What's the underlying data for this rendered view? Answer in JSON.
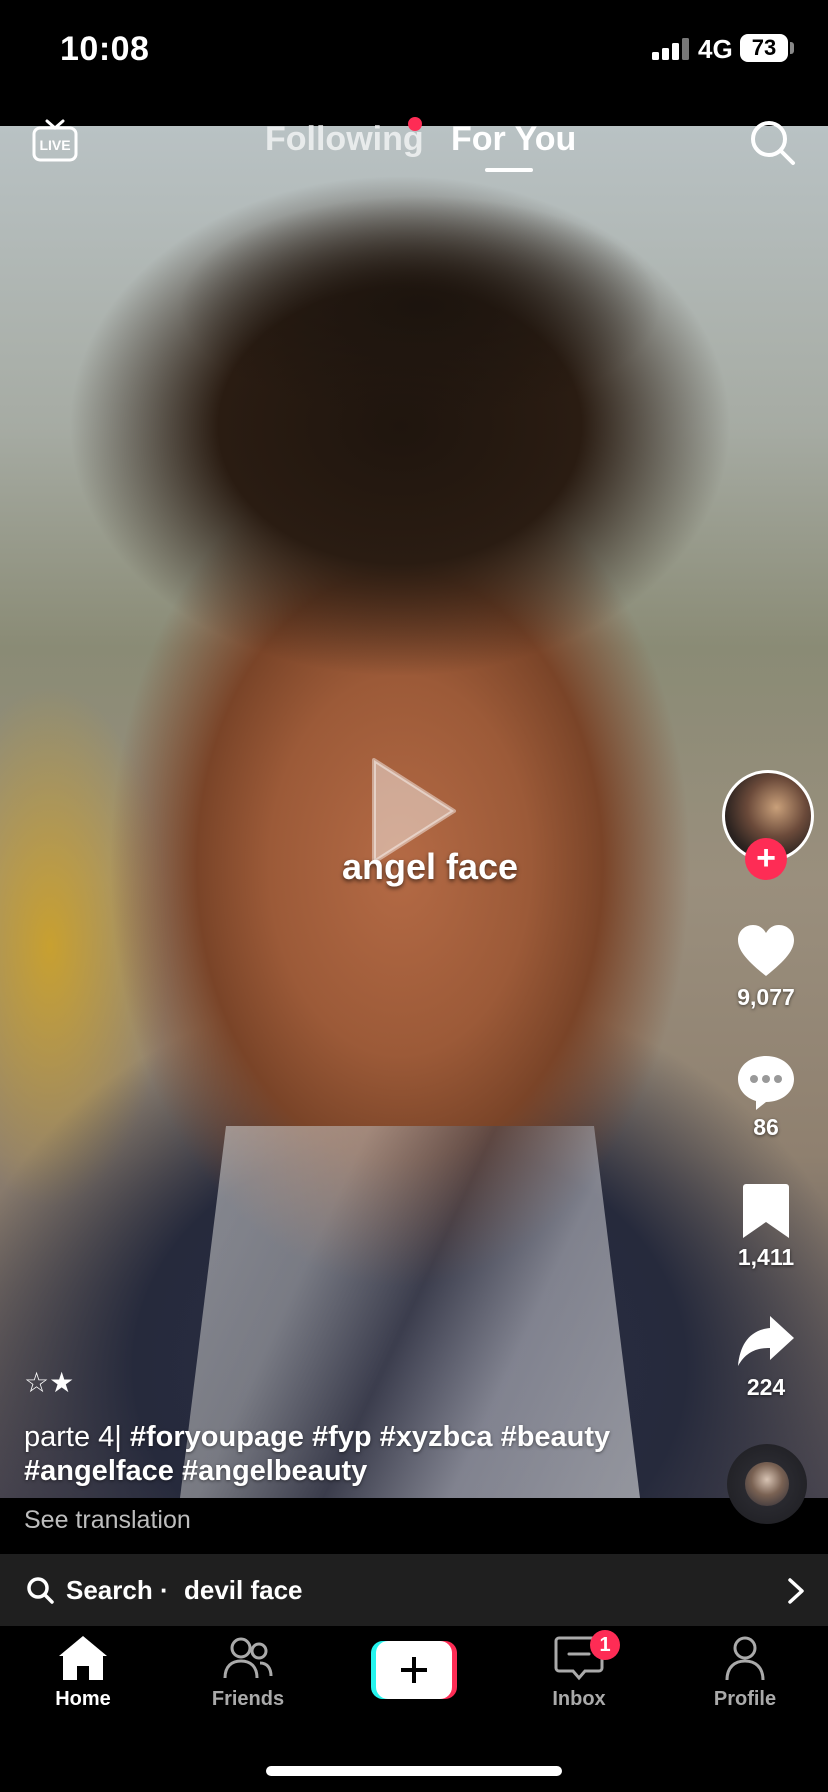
{
  "status_bar": {
    "time": "10:08",
    "network": "4G",
    "battery": "73"
  },
  "top_nav": {
    "tab_following": "Following",
    "tab_for_you": "For You",
    "active_tab": "For You"
  },
  "video": {
    "overlay_text": "angel face"
  },
  "right_rail": {
    "likes": "9,077",
    "comments": "86",
    "saves": "1,411",
    "shares": "224"
  },
  "post": {
    "stars": "☆★",
    "caption_prefix": "parte 4| ",
    "caption_tags": "#foryoupage #fyp #xyzbca #beauty #angelface #angelbeauty",
    "see_translation": "See translation"
  },
  "search_suggestion": {
    "label": "Search ·",
    "query": "devil face"
  },
  "tab_bar": {
    "home": "Home",
    "friends": "Friends",
    "inbox": "Inbox",
    "inbox_badge": "1",
    "profile": "Profile",
    "active": "Home"
  },
  "colors": {
    "accent": "#fe2c55",
    "bar_background": "#1f1f1f",
    "cyan": "#25f4ee"
  }
}
